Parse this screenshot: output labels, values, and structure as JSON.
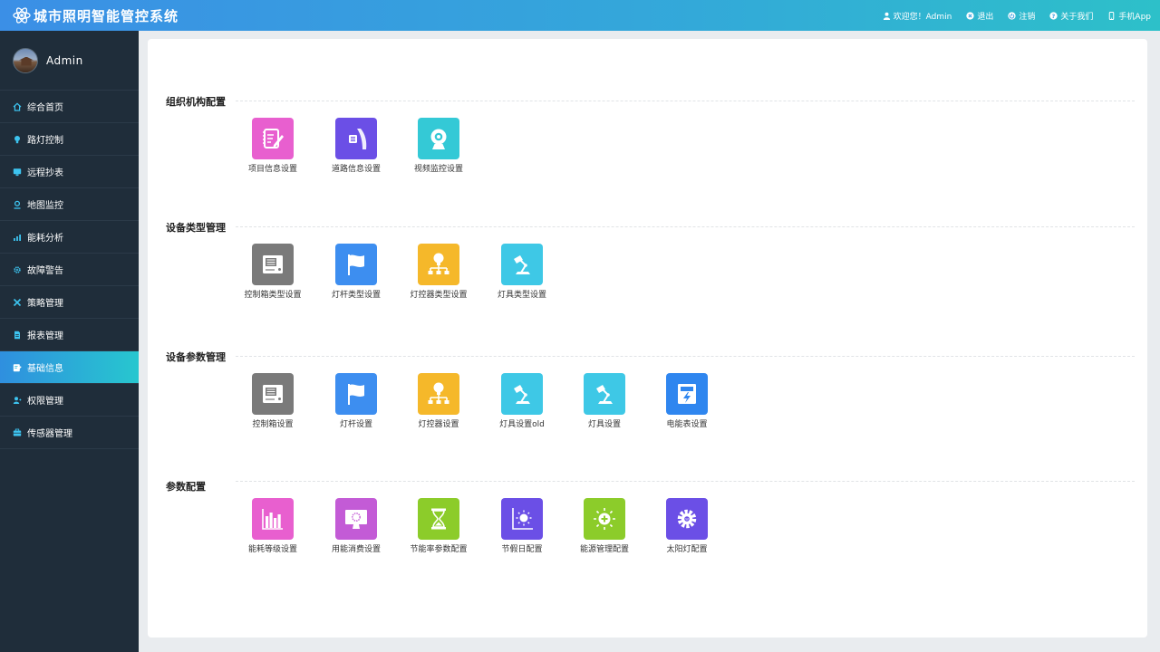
{
  "header": {
    "title": "城市照明智能管控系统",
    "links": [
      {
        "label": "欢迎您！Admin",
        "icon": "user-icon"
      },
      {
        "label": "退出",
        "icon": "close-circle-icon"
      },
      {
        "label": "注销",
        "icon": "power-icon"
      },
      {
        "label": "关于我们",
        "icon": "help-icon"
      },
      {
        "label": "手机App",
        "icon": "phone-icon"
      }
    ]
  },
  "sidebar": {
    "user": "Admin",
    "items": [
      {
        "label": "综合首页",
        "icon": "home-icon"
      },
      {
        "label": "路灯控制",
        "icon": "bulb-icon"
      },
      {
        "label": "远程抄表",
        "icon": "monitor-icon"
      },
      {
        "label": "地图监控",
        "icon": "location-icon"
      },
      {
        "label": "能耗分析",
        "icon": "chart-icon"
      },
      {
        "label": "故障警告",
        "icon": "gear-icon"
      },
      {
        "label": "策略管理",
        "icon": "strategy-icon"
      },
      {
        "label": "报表管理",
        "icon": "report-icon"
      },
      {
        "label": "基础信息",
        "icon": "edit-icon",
        "active": true
      },
      {
        "label": "权限管理",
        "icon": "permission-icon"
      },
      {
        "label": "传感器管理",
        "icon": "sensor-icon"
      }
    ]
  },
  "sections": [
    {
      "title": "组织机构配置",
      "tiles": [
        {
          "label": "项目信息设置",
          "icon": "project-note-icon",
          "color": "#e85fcf"
        },
        {
          "label": "道路信息设置",
          "icon": "road-icon",
          "color": "#6b4fe6"
        },
        {
          "label": "视频监控设置",
          "icon": "webcam-icon",
          "color": "#34c9d6"
        }
      ]
    },
    {
      "title": "设备类型管理",
      "tiles": [
        {
          "label": "控制箱类型设置",
          "icon": "control-box-icon",
          "color": "#7a7a7a"
        },
        {
          "label": "灯杆类型设置",
          "icon": "flag-icon",
          "color": "#3d8ef0"
        },
        {
          "label": "灯控器类型设置",
          "icon": "controller-tree-icon",
          "color": "#f5b82a"
        },
        {
          "label": "灯具类型设置",
          "icon": "desk-lamp-icon",
          "color": "#3ec8e6"
        }
      ]
    },
    {
      "title": "设备参数管理",
      "tiles": [
        {
          "label": "控制箱设置",
          "icon": "control-box-icon",
          "color": "#7a7a7a"
        },
        {
          "label": "灯杆设置",
          "icon": "flag-icon",
          "color": "#3d8ef0"
        },
        {
          "label": "灯控器设置",
          "icon": "controller-tree-icon",
          "color": "#f5b82a"
        },
        {
          "label": "灯具设置old",
          "icon": "desk-lamp-icon",
          "color": "#3ec8e6"
        },
        {
          "label": "灯具设置",
          "icon": "desk-lamp-icon",
          "color": "#3ec8e6"
        },
        {
          "label": "电能表设置",
          "icon": "energy-meter-icon",
          "color": "#2f86ef"
        }
      ]
    },
    {
      "title": "参数配置",
      "tiles": [
        {
          "label": "能耗等级设置",
          "icon": "bar-level-icon",
          "color": "#e85fcf"
        },
        {
          "label": "用能消费设置",
          "icon": "screen-icon",
          "color": "#c35bd6"
        },
        {
          "label": "节能率参数配置",
          "icon": "hourglass-icon",
          "color": "#8ccc2a"
        },
        {
          "label": "节假日配置",
          "icon": "sun-chart-icon",
          "color": "#6b4fe6"
        },
        {
          "label": "能源管理配置",
          "icon": "energy-sun-icon",
          "color": "#8ccc2a"
        },
        {
          "label": "太阳灯配置",
          "icon": "solar-gear-icon",
          "color": "#6b4fe6"
        }
      ]
    }
  ]
}
